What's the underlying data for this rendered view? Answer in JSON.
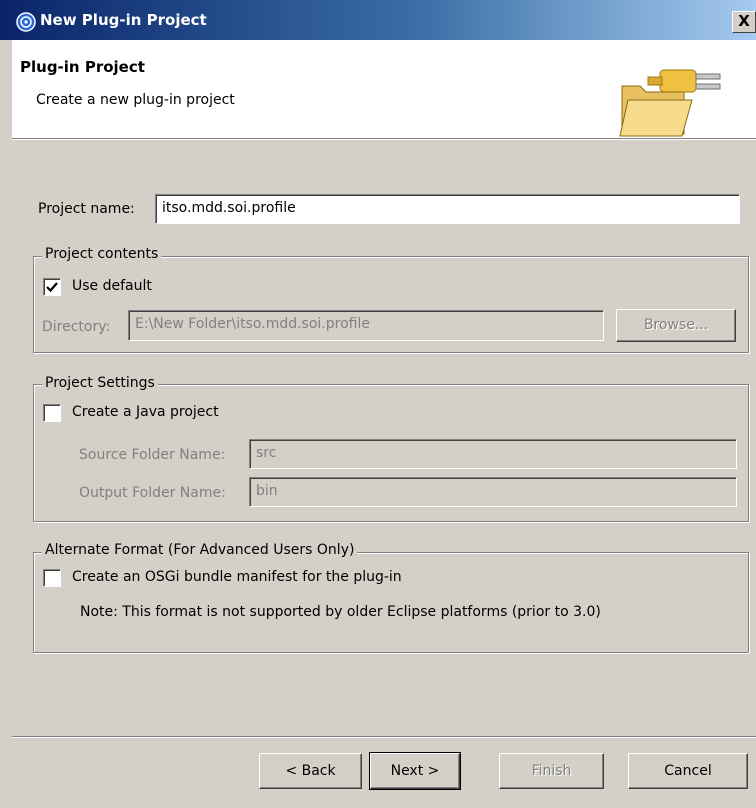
{
  "window": {
    "title": "New Plug-in Project",
    "close_glyph": "X"
  },
  "banner": {
    "title": "Plug-in Project",
    "description": "Create a new plug-in project",
    "icon": "folder-plugin-icon"
  },
  "project_name": {
    "label": "Project name:",
    "value": "itso.mdd.soi.profile"
  },
  "project_contents": {
    "legend": "Project contents",
    "use_default_label": "Use default",
    "use_default_checked": true,
    "directory_label": "Directory:",
    "directory_value": "E:\\New Folder\\itso.mdd.soi.profile",
    "browse_label": "Browse..."
  },
  "project_settings": {
    "legend": "Project Settings",
    "java_project_label": "Create a Java project",
    "java_project_checked": false,
    "source_folder_label": "Source Folder Name:",
    "source_folder_value": "src",
    "output_folder_label": "Output Folder Name:",
    "output_folder_value": "bin"
  },
  "alternate_format": {
    "legend": "Alternate Format (For Advanced Users Only)",
    "osgi_label": "Create an OSGi bundle manifest for the plug-in",
    "osgi_checked": false,
    "note": "Note: This format is not supported by older Eclipse platforms (prior to 3.0)"
  },
  "buttons": {
    "back": "< Back",
    "next": "Next >",
    "finish": "Finish",
    "cancel": "Cancel"
  }
}
